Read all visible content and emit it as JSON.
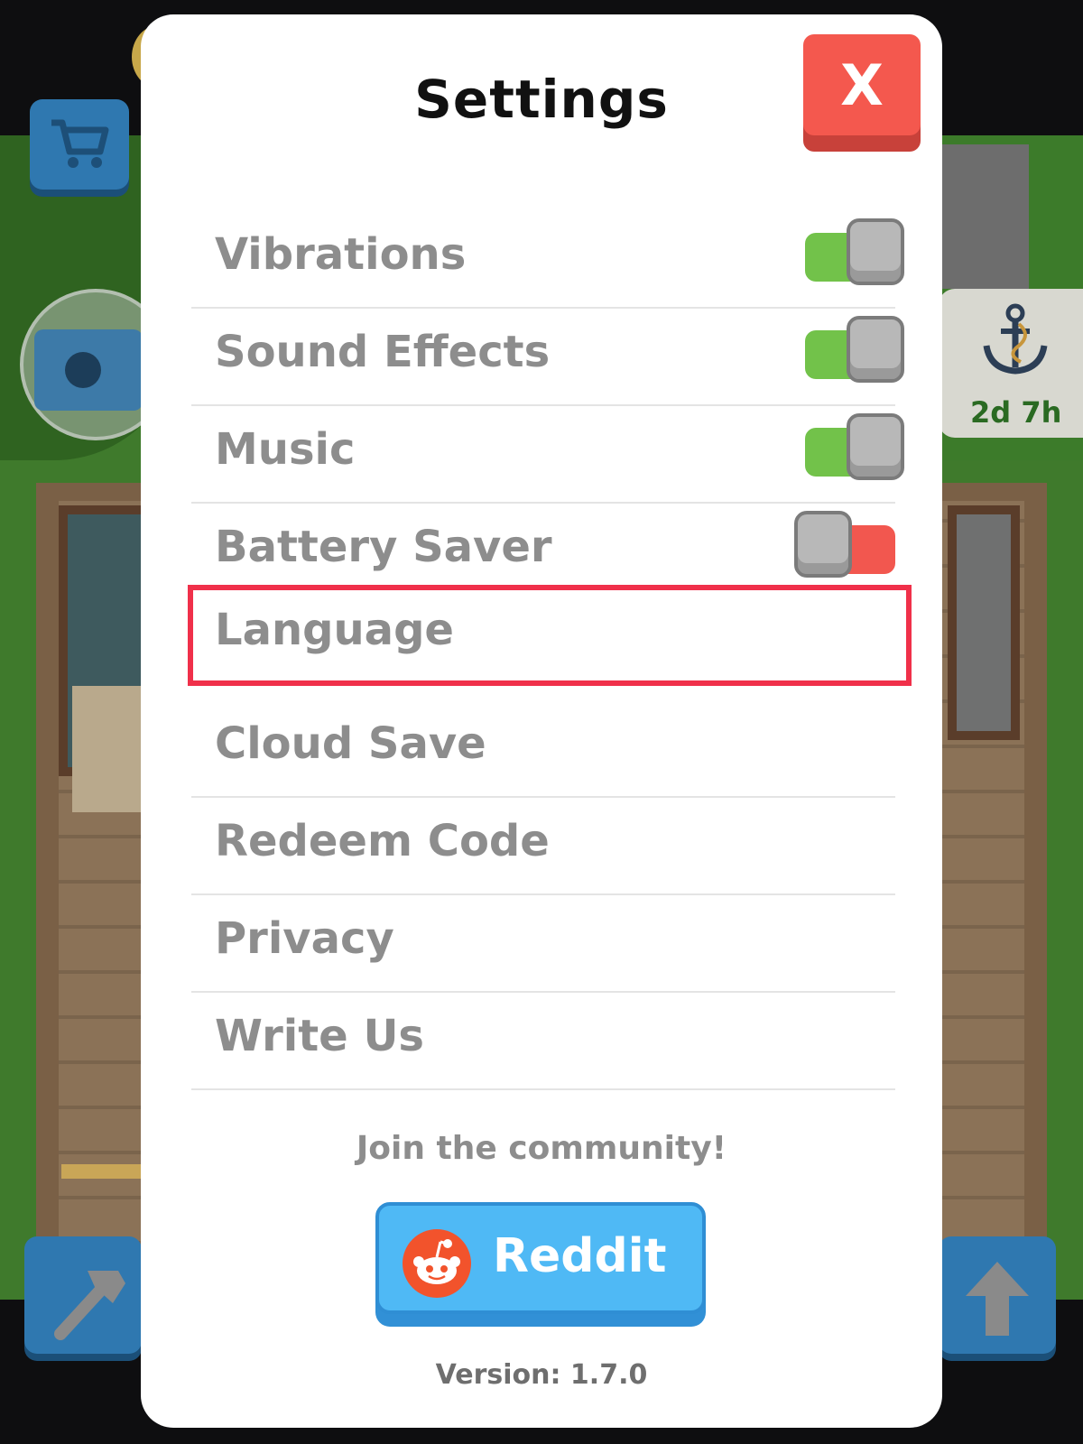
{
  "modal": {
    "title": "Settings",
    "close_label": "X",
    "toggles": {
      "vibrations": {
        "label": "Vibrations",
        "on": true
      },
      "sound_effects": {
        "label": "Sound Effects",
        "on": true
      },
      "music": {
        "label": "Music",
        "on": true
      },
      "battery_saver": {
        "label": "Battery Saver",
        "on": false
      }
    },
    "menu": {
      "language": "Language",
      "cloud_save": "Cloud Save",
      "redeem_code": "Redeem Code",
      "privacy": "Privacy",
      "write_us": "Write Us"
    },
    "community_text": "Join the community!",
    "reddit_label": "Reddit",
    "version": "Version: 1.7.0"
  },
  "hud": {
    "event_timer": "2d 7h"
  },
  "icons": {
    "cart": "cart-icon",
    "camera": "camera-icon",
    "anchor": "anchor-icon",
    "hammer": "hammer-icon",
    "up_arrow": "up-arrow-icon",
    "reddit": "reddit-icon"
  },
  "colors": {
    "toggle_on": "#72c24a",
    "toggle_off": "#f2574f",
    "close_button": "#f4584e",
    "reddit_button": "#4fb9f5",
    "highlight_border": "#f0304a"
  }
}
